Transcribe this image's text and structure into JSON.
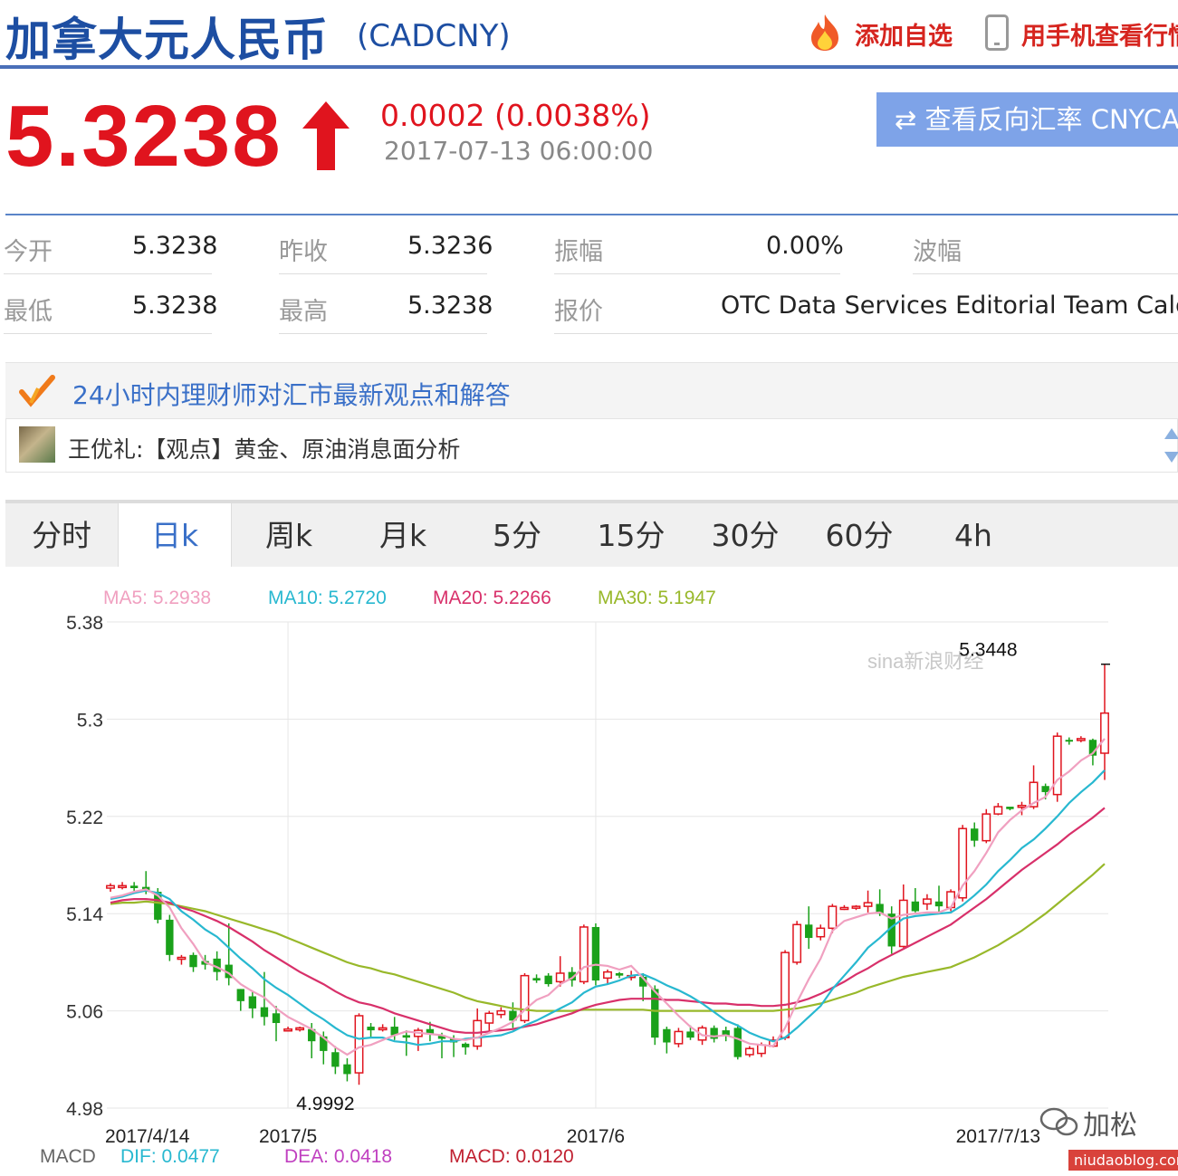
{
  "header": {
    "title": "加拿大元人民币",
    "code": "(CADCNY)",
    "add_watchlist": "添加自选",
    "mobile_view": "用手机查看行情"
  },
  "quote": {
    "price": "5.3238",
    "change": "0.0002 (0.0038%)",
    "time": "2017-07-13 06:00:00",
    "reverse_button": "⇄ 查看反向汇率 CNYCAD"
  },
  "stats": {
    "open_label": "今开",
    "open_value": "5.3238",
    "prev_close_label": "昨收",
    "prev_close_value": "5.3236",
    "amplitude_label": "振幅",
    "amplitude_value": "0.00%",
    "wave_label": "波幅",
    "wave_value": "",
    "low_label": "最低",
    "low_value": "5.3238",
    "high_label": "最高",
    "high_value": "5.3238",
    "quote_label": "报价",
    "quote_value": "OTC Data Services Editorial Team Calculated"
  },
  "advisor": {
    "title": "24小时内理财师对汇市最新观点和解答",
    "item": "王优礼:【观点】黄金、原油消息面分析"
  },
  "tabs": [
    {
      "label": "分时"
    },
    {
      "label": "日k"
    },
    {
      "label": "周k"
    },
    {
      "label": "月k"
    },
    {
      "label": "5分"
    },
    {
      "label": "15分"
    },
    {
      "label": "30分"
    },
    {
      "label": "60分"
    },
    {
      "label": "4h"
    }
  ],
  "active_tab": "日k",
  "colors": {
    "up": "#e0141e",
    "down": "#1aa11a",
    "ma5": "#f0a0c0",
    "ma10": "#28b8d0",
    "ma20": "#d8306a",
    "ma30": "#98b82a",
    "dif": "#28b8d0",
    "dea": "#c040c0",
    "macd": "#c02030"
  },
  "chart_data": {
    "type": "candlestick",
    "ma_legend": [
      {
        "name": "MA5",
        "value": "5.2938"
      },
      {
        "name": "MA10",
        "value": "5.2720"
      },
      {
        "name": "MA20",
        "value": "5.2266"
      },
      {
        "name": "MA30",
        "value": "5.1947"
      }
    ],
    "y_ticks": [
      "5.38",
      "5.3",
      "5.22",
      "5.14",
      "5.06",
      "4.98"
    ],
    "ylim": [
      4.98,
      5.38
    ],
    "x_ticks": [
      {
        "label": "2017/4/14",
        "index": 0
      },
      {
        "label": "2017/5",
        "index": 15
      },
      {
        "label": "2017/6",
        "index": 41
      },
      {
        "label": "2017/7/13",
        "index": 75
      }
    ],
    "annotations": [
      {
        "text": "5.3448",
        "index": 74,
        "value": 5.3448
      },
      {
        "text": "4.9992",
        "index": 18,
        "value": 4.9992
      }
    ],
    "watermark": "sina新浪财经",
    "candles": [
      [
        5.161,
        5.163,
        5.158,
        5.165
      ],
      [
        5.162,
        5.163,
        5.16,
        5.166
      ],
      [
        5.163,
        5.161,
        5.157,
        5.166
      ],
      [
        5.162,
        5.159,
        5.156,
        5.175
      ],
      [
        5.158,
        5.135,
        5.132,
        5.161
      ],
      [
        5.135,
        5.106,
        5.101,
        5.139
      ],
      [
        5.104,
        5.104,
        5.098,
        5.106
      ],
      [
        5.106,
        5.096,
        5.092,
        5.108
      ],
      [
        5.101,
        5.098,
        5.094,
        5.106
      ],
      [
        5.103,
        5.092,
        5.085,
        5.109
      ],
      [
        5.098,
        5.087,
        5.081,
        5.132
      ],
      [
        5.078,
        5.068,
        5.06,
        5.078
      ],
      [
        5.072,
        5.062,
        5.054,
        5.076
      ],
      [
        5.063,
        5.055,
        5.048,
        5.092
      ],
      [
        5.058,
        5.05,
        5.035,
        5.064
      ],
      [
        5.045,
        5.045,
        5.043,
        5.047
      ],
      [
        5.046,
        5.046,
        5.043,
        5.047
      ],
      [
        5.045,
        5.035,
        5.021,
        5.05
      ],
      [
        5.039,
        5.027,
        5.016,
        5.043
      ],
      [
        5.026,
        5.014,
        5.008,
        5.031
      ],
      [
        5.016,
        5.008,
        5.002,
        5.021
      ],
      [
        5.009,
        5.056,
        4.9992,
        5.058
      ],
      [
        5.047,
        5.044,
        5.038,
        5.05
      ],
      [
        5.045,
        5.046,
        5.043,
        5.049
      ],
      [
        5.047,
        5.04,
        5.036,
        5.055
      ],
      [
        5.04,
        5.038,
        5.023,
        5.044
      ],
      [
        5.039,
        5.044,
        5.027,
        5.046
      ],
      [
        5.045,
        5.041,
        5.035,
        5.051
      ],
      [
        5.04,
        5.037,
        5.021,
        5.042
      ],
      [
        5.037,
        5.034,
        5.022,
        5.04
      ],
      [
        5.033,
        5.03,
        5.024,
        5.034
      ],
      [
        5.031,
        5.052,
        5.028,
        5.062
      ],
      [
        5.05,
        5.058,
        5.042,
        5.06
      ],
      [
        5.057,
        5.06,
        5.054,
        5.063
      ],
      [
        5.06,
        5.052,
        5.046,
        5.067
      ],
      [
        5.052,
        5.089,
        5.05,
        5.091
      ],
      [
        5.087,
        5.085,
        5.083,
        5.09
      ],
      [
        5.089,
        5.082,
        5.08,
        5.091
      ],
      [
        5.084,
        5.091,
        5.08,
        5.105
      ],
      [
        5.092,
        5.085,
        5.08,
        5.096
      ],
      [
        5.084,
        5.129,
        5.082,
        5.131
      ],
      [
        5.129,
        5.085,
        5.081,
        5.132
      ],
      [
        5.087,
        5.092,
        5.082,
        5.094
      ],
      [
        5.091,
        5.089,
        5.087,
        5.092
      ],
      [
        5.088,
        5.089,
        5.085,
        5.093
      ],
      [
        5.088,
        5.08,
        5.068,
        5.091
      ],
      [
        5.078,
        5.038,
        5.032,
        5.081
      ],
      [
        5.045,
        5.034,
        5.025,
        5.047
      ],
      [
        5.033,
        5.043,
        5.03,
        5.046
      ],
      [
        5.043,
        5.038,
        5.036,
        5.048
      ],
      [
        5.036,
        5.046,
        5.032,
        5.048
      ],
      [
        5.046,
        5.037,
        5.034,
        5.048
      ],
      [
        5.044,
        5.04,
        5.035,
        5.047
      ],
      [
        5.046,
        5.022,
        5.02,
        5.049
      ],
      [
        5.024,
        5.029,
        5.022,
        5.031
      ],
      [
        5.025,
        5.032,
        5.022,
        5.034
      ],
      [
        5.031,
        5.036,
        5.03,
        5.039
      ],
      [
        5.038,
        5.108,
        5.036,
        5.11
      ],
      [
        5.1,
        5.131,
        5.098,
        5.134
      ],
      [
        5.131,
        5.12,
        5.111,
        5.146
      ],
      [
        5.121,
        5.128,
        5.118,
        5.131
      ],
      [
        5.128,
        5.146,
        5.124,
        5.148
      ],
      [
        5.145,
        5.145,
        5.143,
        5.147
      ],
      [
        5.145,
        5.146,
        5.143,
        5.147
      ],
      [
        5.146,
        5.149,
        5.141,
        5.159
      ],
      [
        5.148,
        5.14,
        5.138,
        5.16
      ],
      [
        5.14,
        5.113,
        5.107,
        5.146
      ],
      [
        5.113,
        5.151,
        5.112,
        5.164
      ],
      [
        5.15,
        5.142,
        5.141,
        5.161
      ],
      [
        5.148,
        5.152,
        5.143,
        5.156
      ],
      [
        5.15,
        5.146,
        5.14,
        5.163
      ],
      [
        5.145,
        5.158,
        5.142,
        5.16
      ],
      [
        5.153,
        5.21,
        5.15,
        5.213
      ],
      [
        5.21,
        5.2,
        5.195,
        5.215
      ],
      [
        5.2,
        5.222,
        5.198,
        5.226
      ],
      [
        5.222,
        5.228,
        5.221,
        5.231
      ],
      [
        5.228,
        5.226,
        5.225,
        5.227
      ],
      [
        5.228,
        5.229,
        5.221,
        5.232
      ],
      [
        5.228,
        5.248,
        5.226,
        5.262
      ],
      [
        5.245,
        5.24,
        5.234,
        5.247
      ],
      [
        5.238,
        5.286,
        5.232,
        5.289
      ],
      [
        5.283,
        5.282,
        5.279,
        5.285
      ],
      [
        5.284,
        5.284,
        5.281,
        5.286
      ],
      [
        5.283,
        5.27,
        5.262,
        5.284
      ],
      [
        5.272,
        5.305,
        5.25,
        5.3448
      ]
    ],
    "ma5": [
      5.153,
      5.155,
      5.158,
      5.16,
      5.155,
      5.145,
      5.128,
      5.115,
      5.1,
      5.096,
      5.091,
      5.082,
      5.076,
      5.071,
      5.062,
      5.055,
      5.05,
      5.045,
      5.038,
      5.03,
      5.024,
      5.03,
      5.032,
      5.036,
      5.04,
      5.043,
      5.042,
      5.041,
      5.04,
      5.037,
      5.036,
      5.038,
      5.042,
      5.046,
      5.051,
      5.061,
      5.069,
      5.073,
      5.082,
      5.087,
      5.096,
      5.098,
      5.097,
      5.094,
      5.097,
      5.087,
      5.076,
      5.066,
      5.056,
      5.047,
      5.04,
      5.039,
      5.04,
      5.037,
      5.033,
      5.032,
      5.031,
      5.046,
      5.067,
      5.086,
      5.103,
      5.126,
      5.134,
      5.137,
      5.14,
      5.141,
      5.136,
      5.139,
      5.14,
      5.141,
      5.141,
      5.145,
      5.163,
      5.175,
      5.19,
      5.207,
      5.217,
      5.225,
      5.231,
      5.236,
      5.25,
      5.257,
      5.266,
      5.272,
      5.284
    ],
    "ma10": [
      5.152,
      5.154,
      5.157,
      5.159,
      5.157,
      5.152,
      5.142,
      5.135,
      5.127,
      5.121,
      5.112,
      5.103,
      5.095,
      5.086,
      5.079,
      5.073,
      5.066,
      5.059,
      5.053,
      5.046,
      5.04,
      5.037,
      5.038,
      5.038,
      5.035,
      5.034,
      5.032,
      5.033,
      5.035,
      5.035,
      5.037,
      5.038,
      5.039,
      5.04,
      5.043,
      5.048,
      5.052,
      5.057,
      5.062,
      5.067,
      5.075,
      5.08,
      5.082,
      5.085,
      5.089,
      5.09,
      5.086,
      5.081,
      5.077,
      5.072,
      5.066,
      5.059,
      5.052,
      5.048,
      5.042,
      5.038,
      5.035,
      5.038,
      5.046,
      5.055,
      5.064,
      5.078,
      5.089,
      5.1,
      5.112,
      5.12,
      5.129,
      5.136,
      5.138,
      5.139,
      5.14,
      5.141,
      5.147,
      5.155,
      5.164,
      5.175,
      5.184,
      5.194,
      5.201,
      5.21,
      5.22,
      5.231,
      5.24,
      5.248,
      5.258
    ],
    "ma20": [
      5.149,
      5.151,
      5.152,
      5.152,
      5.151,
      5.149,
      5.145,
      5.142,
      5.138,
      5.134,
      5.129,
      5.123,
      5.117,
      5.11,
      5.104,
      5.098,
      5.092,
      5.087,
      5.082,
      5.076,
      5.071,
      5.067,
      5.065,
      5.062,
      5.058,
      5.055,
      5.052,
      5.049,
      5.046,
      5.043,
      5.042,
      5.042,
      5.043,
      5.044,
      5.045,
      5.047,
      5.049,
      5.052,
      5.055,
      5.058,
      5.062,
      5.065,
      5.067,
      5.069,
      5.07,
      5.07,
      5.07,
      5.069,
      5.069,
      5.068,
      5.067,
      5.066,
      5.066,
      5.065,
      5.065,
      5.064,
      5.064,
      5.065,
      5.067,
      5.07,
      5.074,
      5.079,
      5.084,
      5.09,
      5.095,
      5.101,
      5.106,
      5.111,
      5.116,
      5.121,
      5.126,
      5.131,
      5.138,
      5.145,
      5.152,
      5.16,
      5.168,
      5.176,
      5.183,
      5.19,
      5.197,
      5.205,
      5.212,
      5.219,
      5.227
    ],
    "ma30": [
      5.148,
      5.149,
      5.149,
      5.15,
      5.149,
      5.148,
      5.146,
      5.144,
      5.142,
      5.139,
      5.136,
      5.133,
      5.13,
      5.127,
      5.124,
      5.12,
      5.116,
      5.112,
      5.108,
      5.104,
      5.1,
      5.097,
      5.095,
      5.092,
      5.09,
      5.087,
      5.084,
      5.081,
      5.078,
      5.075,
      5.071,
      5.068,
      5.066,
      5.064,
      5.062,
      5.061,
      5.06,
      5.06,
      5.06,
      5.06,
      5.061,
      5.061,
      5.061,
      5.061,
      5.061,
      5.061,
      5.06,
      5.06,
      5.06,
      5.06,
      5.06,
      5.06,
      5.06,
      5.06,
      5.06,
      5.06,
      5.06,
      5.061,
      5.062,
      5.064,
      5.066,
      5.069,
      5.072,
      5.075,
      5.079,
      5.082,
      5.085,
      5.088,
      5.09,
      5.092,
      5.094,
      5.096,
      5.1,
      5.104,
      5.109,
      5.114,
      5.12,
      5.126,
      5.133,
      5.14,
      5.148,
      5.156,
      5.164,
      5.172,
      5.181
    ],
    "macd_legend": {
      "label": "MACD",
      "dif": "DIF: 0.0477",
      "dea": "DEA: 0.0418",
      "macd": "MACD: 0.0120"
    }
  },
  "watermark_footer": {
    "name": "加松",
    "site": "niudaoblog.com"
  }
}
